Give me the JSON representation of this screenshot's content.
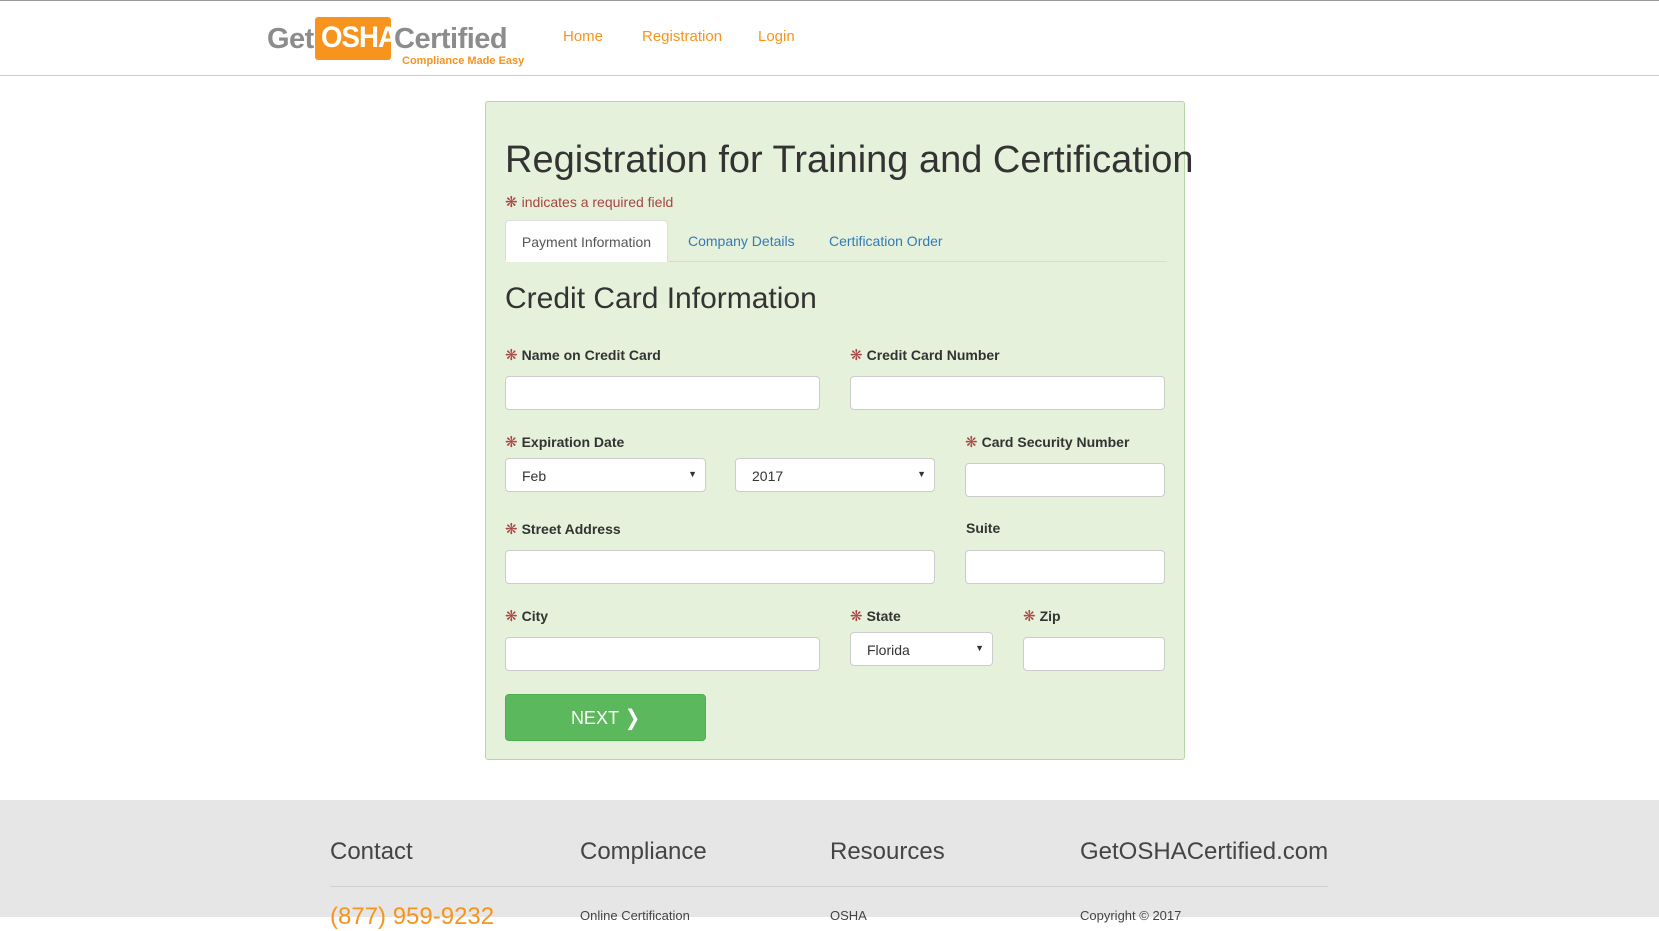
{
  "header": {
    "logo": {
      "get": "Get",
      "osha": "OSHA",
      "certified": "Certified",
      "tagline": "Compliance Made Easy"
    },
    "nav": [
      "Home",
      "Registration",
      "Login"
    ]
  },
  "form": {
    "title": "Registration for Training and Certification",
    "required_note": "indicates a required field",
    "tabs": [
      {
        "label": "Payment Information",
        "active": true
      },
      {
        "label": "Company Details",
        "active": false
      },
      {
        "label": "Certification Order",
        "active": false
      }
    ],
    "section_title": "Credit Card Information",
    "fields": {
      "name_on_card": {
        "label": "Name on Credit Card",
        "value": ""
      },
      "card_number": {
        "label": "Credit Card Number",
        "value": ""
      },
      "expiration": {
        "label": "Expiration Date",
        "month": "Feb",
        "year": "2017"
      },
      "security": {
        "label": "Card Security Number",
        "value": ""
      },
      "street": {
        "label": "Street Address",
        "value": ""
      },
      "suite": {
        "label": "Suite",
        "value": ""
      },
      "city": {
        "label": "City",
        "value": ""
      },
      "state": {
        "label": "State",
        "value": "Florida"
      },
      "zip": {
        "label": "Zip",
        "value": ""
      }
    },
    "next_label": "NEXT",
    "required_symbol": "❋"
  },
  "footer": {
    "columns": [
      "Contact",
      "Compliance",
      "Resources",
      "GetOSHACertified.com"
    ],
    "phone": "(877) 959-9232",
    "items": [
      "Online Certification",
      "OSHA",
      "Copyright © 2017"
    ]
  },
  "colors": {
    "accent": "#f7941d",
    "panel": "#e5f1da",
    "button": "#5cb85c",
    "required": "#a94442",
    "link": "#337ab7"
  },
  "icons": {
    "next": "chevron-right-icon",
    "caret": "caret-down-icon",
    "required": "asterisk-icon"
  }
}
